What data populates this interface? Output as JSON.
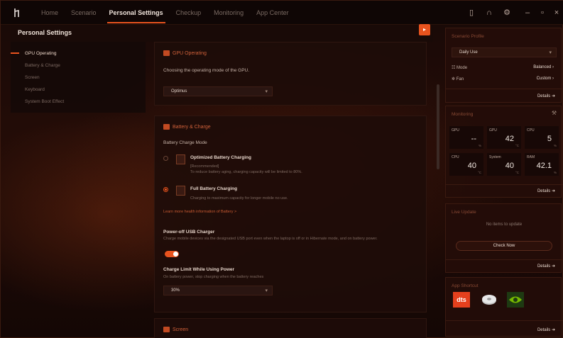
{
  "nav": {
    "items": [
      "Home",
      "Scenario",
      "Personal Settings",
      "Checkup",
      "Monitoring",
      "App Center"
    ],
    "active": "Personal Settings"
  },
  "page_title": "Personal Settings",
  "left_nav": {
    "items": [
      "GPU Operating",
      "Battery & Charge",
      "Screen",
      "Keyboard",
      "System Boot Effect"
    ],
    "active_index": 0
  },
  "gpu": {
    "title": "GPU Operating",
    "description": "Choosing the operating mode of the GPU.",
    "selected": "Optimus"
  },
  "battery": {
    "title": "Battery & Charge",
    "mode_label": "Battery Charge Mode",
    "options": [
      {
        "title": "Optimized Battery Charging",
        "tag": "[Recommended]",
        "desc": "To reduce battery aging, charging capacity will be limited to 80%.",
        "selected": false
      },
      {
        "title": "Full Battery Charging",
        "desc": "Charging to maximum capacity for longer mobile no use.",
        "selected": true
      }
    ],
    "learn_more": "Learn more health information of Battery >",
    "usb_title": "Power-off USB Charger",
    "usb_desc": "Charge mobile devices via the designated USB port even when the laptop is off or in Hibernate mode, and on battery power.",
    "usb_enabled": true,
    "limit_title": "Charge Limit While Using Power",
    "limit_desc": "On battery power, stop charging when the battery reaches",
    "limit_value": "30%"
  },
  "screen": {
    "title": "Screen"
  },
  "scenario_profile": {
    "title": "Scenario Profile",
    "selected": "Daily Use",
    "rows": [
      {
        "label": "Mode",
        "value": "Balanced"
      },
      {
        "label": "Fan",
        "value": "Custom"
      }
    ],
    "details": "Details"
  },
  "monitoring": {
    "title": "Monitoring",
    "cells": [
      {
        "label": "GPU",
        "value": "--",
        "unit": "%"
      },
      {
        "label": "GPU",
        "value": "42",
        "unit": "°C"
      },
      {
        "label": "CPU",
        "value": "5",
        "unit": "%"
      },
      {
        "label": "CPU",
        "value": "40",
        "unit": "°C"
      },
      {
        "label": "System",
        "value": "40",
        "unit": "°C"
      },
      {
        "label": "RAM",
        "value": "42.1",
        "unit": "%"
      }
    ],
    "details": "Details"
  },
  "live_update": {
    "title": "Live Update",
    "message": "No items to update",
    "button": "Check Now",
    "details": "Details"
  },
  "app_shortcut": {
    "title": "App Shortcut",
    "apps": [
      "dts",
      "disk-app",
      "nvidia-app"
    ],
    "details": "Details"
  },
  "colors": {
    "accent": "#e8531e",
    "background": "#1a0906",
    "panel": "#24100b"
  }
}
